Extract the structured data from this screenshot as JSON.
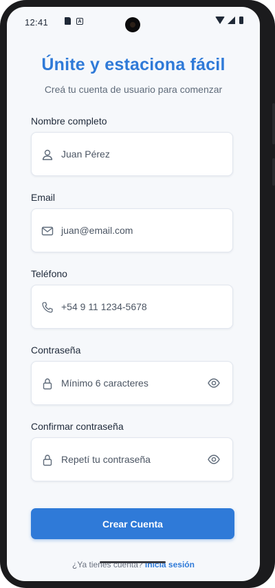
{
  "status_bar": {
    "time": "12:41",
    "a_badge": "A"
  },
  "header": {
    "title": "Únite y estaciona fácil",
    "subtitle": "Creá tu cuenta de usuario para comenzar"
  },
  "form": {
    "fields": [
      {
        "label": "Nombre completo",
        "value": "Juan Pérez",
        "icon": "user-icon"
      },
      {
        "label": "Email",
        "value": "juan@email.com",
        "icon": "mail-icon"
      },
      {
        "label": "Teléfono",
        "value": "+54 9 11 1234-5678",
        "icon": "phone-icon"
      },
      {
        "label": "Contraseña",
        "value": "Mínimo 6 caracteres",
        "icon": "lock-icon",
        "trailing_icon": "eye-icon"
      },
      {
        "label": "Confirmar contraseña",
        "value": "Repetí tu contraseña",
        "icon": "lock-icon",
        "trailing_icon": "eye-icon"
      }
    ],
    "submit_label": "Crear Cuenta"
  },
  "footer": {
    "prompt": "¿Ya tienes cuenta?",
    "link": "Inicia sesión"
  },
  "colors": {
    "accent": "#2f7ad8",
    "background": "#f6f8fb"
  }
}
